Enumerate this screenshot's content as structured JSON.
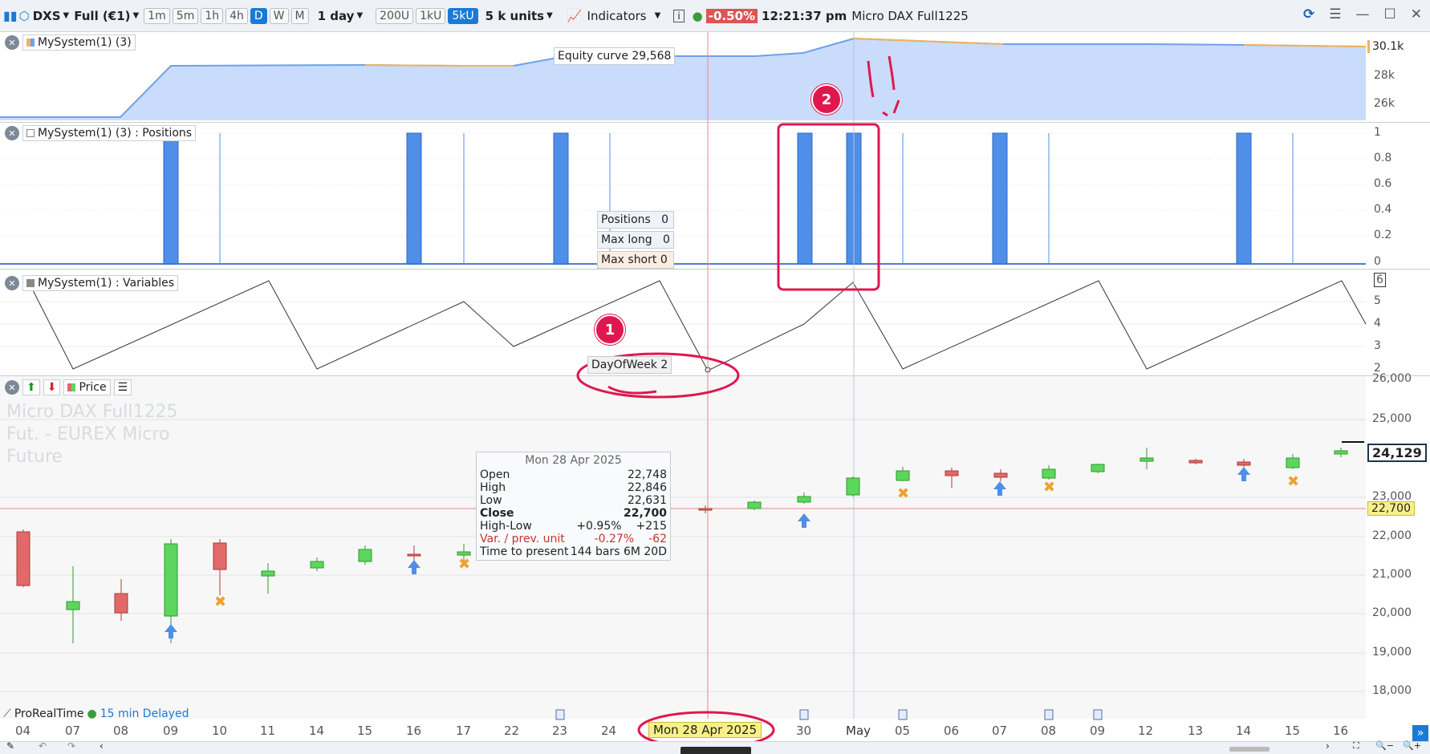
{
  "toolbar": {
    "logo_label": "DXS",
    "data_label": "Full (€1)",
    "intervals": [
      "1m",
      "5m",
      "1h",
      "4h",
      "D",
      "W",
      "M"
    ],
    "active_interval": "D",
    "period_label": "1 day",
    "units_buttons": [
      "200U",
      "1kU",
      "5kU"
    ],
    "active_units": "5kU",
    "units_label": "5 k units",
    "indicators_label": "Indicators",
    "change_pct": "-0.50%",
    "clock": "12:21:37 pm",
    "instrument": "Micro DAX Full1225"
  },
  "panels": {
    "equity": {
      "label": "MySystem(1) (3)",
      "tooltip": "Equity curve 29,568",
      "current_value": "30.1k",
      "axis": [
        "28k",
        "26k"
      ],
      "colors": {
        "fill": "#c9dcfb",
        "line": "#6fa0ec",
        "highlight": "#f2b35a"
      }
    },
    "positions": {
      "label": "MySystem(1) (3) : Positions",
      "axis": [
        "1",
        "0.8",
        "0.6",
        "0.4",
        "0.2",
        "0"
      ],
      "stats": [
        {
          "label": "Positions",
          "value": "0"
        },
        {
          "label": "Max long",
          "value": "0"
        },
        {
          "label": "Max short",
          "value": "0"
        }
      ]
    },
    "variables": {
      "label": "MySystem(1) : Variables",
      "axis": [
        "6",
        "5",
        "4",
        "3",
        "2"
      ],
      "tooltip": "DayOfWeek 2"
    },
    "price": {
      "label": "Price",
      "watermark": [
        "Micro DAX Full1225",
        "Fut. - EUREX Micro",
        "Future"
      ],
      "axis": [
        "26,000",
        "25,000",
        "23,000",
        "22,000",
        "21,000",
        "20,000",
        "19,000",
        "18,000"
      ],
      "last_price": "24,129",
      "crosshair_price": "22,700",
      "ohlc": {
        "date": "Mon 28 Apr 2025",
        "rows": [
          {
            "label": "Open",
            "value": "22,748",
            "extra": ""
          },
          {
            "label": "High",
            "value": "22,846",
            "extra": ""
          },
          {
            "label": "Low",
            "value": "22,631",
            "extra": ""
          },
          {
            "label": "Close",
            "value": "22,700",
            "extra": ""
          },
          {
            "label": "High-Low",
            "value": "+0.95%",
            "extra": "+215"
          },
          {
            "label": "Var. / prev. unit",
            "value": "-0.27%",
            "extra": "-62"
          },
          {
            "label": "Time to present",
            "value": "144 bars 6M 20D",
            "extra": ""
          }
        ]
      }
    }
  },
  "annotations": {
    "marker1": "1",
    "marker2": "2"
  },
  "footer": {
    "brand": "ProRealTime",
    "delay": "15 min Delayed"
  },
  "xaxis": {
    "labels": [
      "04",
      "07",
      "08",
      "09",
      "10",
      "11",
      "14",
      "15",
      "16",
      "17",
      "22",
      "23",
      "24",
      "9",
      "30",
      "May",
      "05",
      "06",
      "07",
      "08",
      "09",
      "12",
      "13",
      "14",
      "15",
      "16"
    ],
    "crosshair_date": "Mon 28 Apr 2025"
  },
  "colors": {
    "up": "#5cd65c",
    "down": "#e06a6a",
    "accent": "#1a7ad6",
    "crosshair": "#e28a8a",
    "annotation": "#e0174f"
  }
}
